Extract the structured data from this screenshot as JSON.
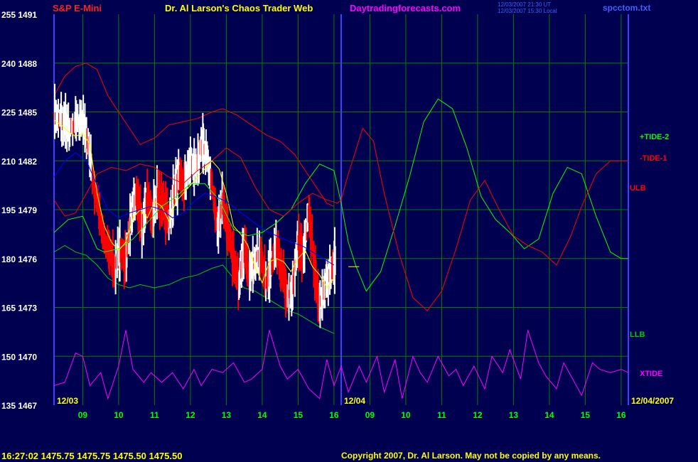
{
  "header": {
    "symbol": "S&P E-Mini",
    "site_title": "Dr. Al Larson's Chaos Trader Web",
    "url": "Daytradingforecasts.com",
    "timestamp_line1": "12/03/2007 21:30 UT",
    "timestamp_line2": "12/03/2007 15:30 Local",
    "filename": "spcctom.txt"
  },
  "footer": {
    "quote": "16:27:02  1475.75  1475.75  1475.50  1475.50",
    "copyright": "Copyright 2007, Dr. Al Larson. May not be copied by any means."
  },
  "colors": {
    "background": "#000050",
    "grid": "#008000",
    "frame": "#4040ff",
    "price_high": "#ffffff",
    "price_low": "#ff0000",
    "fast_average": "#ffff00",
    "slow_average": "#0000ff",
    "tide_plus_2": "#00ff00",
    "tide_minus_1": "#ff0000",
    "ulb": "#ff0000",
    "llb": "#00cc00",
    "xtide": "#ff00ff",
    "y_labels": "#ffffff",
    "x_labels": "#00ff00",
    "date_labels": "#ffff00"
  },
  "chart_data": {
    "type": "line",
    "y_axis": {
      "ticks": [
        {
          "osc": "255",
          "price": "1491"
        },
        {
          "osc": "240",
          "price": "1488"
        },
        {
          "osc": "225",
          "price": "1485"
        },
        {
          "osc": "210",
          "price": "1482"
        },
        {
          "osc": "195",
          "price": "1479"
        },
        {
          "osc": "180",
          "price": "1476"
        },
        {
          "osc": "165",
          "price": "1473"
        },
        {
          "osc": "150",
          "price": "1470"
        },
        {
          "osc": "135",
          "price": "1467"
        }
      ],
      "osc_range": [
        135,
        255
      ],
      "price_range": [
        1467,
        1491
      ],
      "grid": true
    },
    "x_axis": {
      "hour_ticks": [
        "09",
        "10",
        "11",
        "12",
        "13",
        "14",
        "15",
        "16",
        "09",
        "10",
        "11",
        "12",
        "13",
        "14",
        "15",
        "16"
      ],
      "range": [
        8.2,
        24.2
      ],
      "day_labels": [
        "12/03",
        "12/04",
        "12/04/2007"
      ],
      "day_divider": 16.2,
      "grid": true
    },
    "legend": {
      "tide_plus_2": "+TIDE-2",
      "tide_minus_1": "-TIDE-1",
      "ulb": "ULB",
      "llb": "LLB",
      "xtide": "XTIDE"
    },
    "series": [
      {
        "name": "+TIDE-2",
        "key": "tide_plus_2",
        "x": [
          8.2,
          8.6,
          9.0,
          9.4,
          9.6,
          10.0,
          10.4,
          10.8,
          11.2,
          11.6,
          12.0,
          12.4,
          12.8,
          13.2,
          13.6,
          14.0,
          14.4,
          14.8,
          15.2,
          15.6,
          16.0,
          16.2,
          16.4,
          16.6,
          16.9,
          17.3,
          17.7,
          18.1,
          18.5,
          18.9,
          19.3,
          19.7,
          20.1,
          20.5,
          20.9,
          21.3,
          21.7,
          22.1,
          22.5,
          22.9,
          23.3,
          23.7,
          24.0,
          24.2
        ],
        "y": [
          188,
          192,
          193,
          183,
          182,
          183,
          186,
          191,
          196,
          199,
          203,
          203,
          198,
          189,
          187,
          188,
          191,
          195,
          203,
          209,
          207,
          197,
          185,
          178,
          170,
          176,
          190,
          205,
          222,
          229,
          226,
          214,
          199,
          192,
          188,
          183,
          186,
          200,
          208,
          206,
          193,
          182,
          180,
          180
        ]
      },
      {
        "name": "-TIDE-1",
        "key": "tide_minus_1",
        "x": [
          8.2,
          8.5,
          8.8,
          9.1,
          9.4,
          9.8,
          10.2,
          10.6,
          11.0,
          11.4,
          11.8,
          12.2,
          12.6,
          13.0,
          13.4,
          13.8,
          14.2,
          14.6,
          15.0,
          15.4,
          15.8,
          16.1,
          16.2,
          16.4,
          16.8,
          17.1,
          17.4,
          17.8,
          18.2,
          18.6,
          19.0,
          19.4,
          19.8,
          20.2,
          20.6,
          21.0,
          21.4,
          21.8,
          22.2,
          22.6,
          22.9,
          23.3,
          23.7,
          24.0,
          24.2
        ],
        "y": [
          198,
          193,
          194,
          200,
          206,
          208,
          207,
          209,
          208,
          205,
          203,
          207,
          210,
          214,
          211,
          202,
          195,
          193,
          197,
          200,
          198,
          197,
          198,
          206,
          220,
          216,
          200,
          182,
          168,
          164,
          170,
          183,
          198,
          204,
          195,
          187,
          184,
          182,
          178,
          187,
          196,
          206,
          210,
          210,
          210
        ]
      },
      {
        "name": "ULB",
        "key": "ulb",
        "x": [
          8.2,
          8.5,
          8.8,
          9.1,
          9.4,
          9.7,
          10.0,
          10.3,
          10.6,
          11.0,
          11.4,
          11.8,
          12.2,
          12.6,
          12.9,
          13.3,
          13.7,
          14.1,
          14.5,
          14.9,
          15.2,
          15.5,
          15.8,
          16.0
        ],
        "y": [
          230,
          236,
          239,
          240,
          238,
          230,
          225,
          220,
          215,
          217,
          221,
          222,
          223,
          225,
          226,
          224,
          221,
          218,
          216,
          212,
          207,
          202,
          197,
          196
        ]
      },
      {
        "name": "LLB",
        "key": "llb",
        "x": [
          8.2,
          8.5,
          8.8,
          9.1,
          9.4,
          9.7,
          10.0,
          10.3,
          10.6,
          11.0,
          11.4,
          11.8,
          12.2,
          12.6,
          12.9,
          13.2,
          13.5,
          13.8,
          14.1,
          14.4,
          14.7,
          15.0,
          15.3,
          15.6,
          15.8,
          16.0
        ],
        "y": [
          182,
          184,
          182,
          181,
          178,
          174,
          172,
          171,
          172,
          171,
          172,
          174,
          175,
          177,
          178,
          174,
          171,
          170,
          168,
          166,
          164,
          163,
          161,
          159,
          158,
          157
        ]
      },
      {
        "name": "XTIDE",
        "key": "xtide",
        "x": [
          8.2,
          8.5,
          8.8,
          9.0,
          9.2,
          9.5,
          9.7,
          10.0,
          10.2,
          10.4,
          10.7,
          10.9,
          11.2,
          11.5,
          11.8,
          12.1,
          12.3,
          12.6,
          12.9,
          13.2,
          13.5,
          13.7,
          14.0,
          14.2,
          14.5,
          14.7,
          15.0,
          15.3,
          15.6,
          15.8,
          16.0,
          16.2,
          16.4,
          16.7,
          16.9,
          17.2,
          17.4,
          17.7,
          17.9,
          18.2,
          18.4,
          18.6,
          18.9,
          19.2,
          19.4,
          19.6,
          19.9,
          20.2,
          20.4,
          20.7,
          20.9,
          21.2,
          21.4,
          21.7,
          21.9,
          22.2,
          22.4,
          22.7,
          22.9,
          23.2,
          23.4,
          23.7,
          24.0,
          24.2
        ],
        "y": [
          141,
          142,
          151,
          150,
          141,
          145,
          137,
          147,
          158,
          146,
          142,
          145,
          142,
          145,
          140,
          146,
          141,
          146,
          145,
          148,
          142,
          143,
          146,
          158,
          147,
          143,
          146,
          140,
          137,
          149,
          141,
          147,
          139,
          147,
          142,
          150,
          139,
          149,
          137,
          150,
          145,
          142,
          150,
          144,
          146,
          141,
          147,
          140,
          150,
          145,
          152,
          143,
          158,
          148,
          144,
          140,
          148,
          142,
          138,
          148,
          146,
          145,
          146,
          145
        ]
      },
      {
        "name": "fast average",
        "key": "fast_average",
        "x": [
          8.2,
          8.4,
          8.6,
          8.8,
          9.0,
          9.2,
          9.4,
          9.6,
          9.8,
          10.0,
          10.2,
          10.4,
          10.6,
          10.8,
          11.0,
          11.2,
          11.4,
          11.6,
          11.8,
          12.0,
          12.2,
          12.4,
          12.6,
          12.8,
          13.0,
          13.2,
          13.4,
          13.6,
          13.8,
          14.0,
          14.2,
          14.4,
          14.6,
          14.8,
          15.0,
          15.2,
          15.4,
          15.6,
          15.8,
          16.0
        ],
        "y": [
          1484.5,
          1484.2,
          1483.8,
          1483.5,
          1483.7,
          1483.0,
          1480.0,
          1478.0,
          1477.0,
          1476.5,
          1477.0,
          1478.5,
          1479.0,
          1478.5,
          1479.5,
          1479.2,
          1478.3,
          1479.5,
          1480.0,
          1480.5,
          1481.0,
          1481.5,
          1482.0,
          1481.5,
          1480.0,
          1478.0,
          1477.5,
          1476.8,
          1475.5,
          1474.5,
          1475.8,
          1476.0,
          1475.8,
          1475.2,
          1476.0,
          1476.5,
          1475.5,
          1475.0,
          1474.2,
          1474.8
        ]
      },
      {
        "name": "slow average",
        "key": "slow_average",
        "x": [
          8.2,
          8.5,
          8.8,
          9.1,
          9.4,
          9.7,
          10.0,
          10.3,
          10.6,
          10.9,
          11.2,
          11.5,
          11.8,
          12.1,
          12.4,
          12.7,
          13.0,
          13.3,
          13.6,
          13.9,
          14.2,
          14.5,
          14.8,
          15.1,
          15.4,
          15.7,
          16.0
        ],
        "y": [
          1481.0,
          1482.0,
          1482.5,
          1482.0,
          1480.5,
          1479.0,
          1478.5,
          1478.8,
          1479.0,
          1479.2,
          1479.0,
          1478.5,
          1478.8,
          1479.5,
          1480.0,
          1479.8,
          1479.5,
          1479.0,
          1478.5,
          1478.0,
          1477.6,
          1477.3,
          1477.0,
          1476.8,
          1476.4,
          1476.0,
          1475.6
        ]
      },
      {
        "name": "price",
        "key": "price",
        "x": [
          8.2,
          8.4,
          8.6,
          8.8,
          9.0,
          9.15,
          9.3,
          9.45,
          9.6,
          9.75,
          9.9,
          10.05,
          10.2,
          10.35,
          10.5,
          10.65,
          10.8,
          10.95,
          11.1,
          11.25,
          11.4,
          11.55,
          11.7,
          11.85,
          12.0,
          12.15,
          12.3,
          12.45,
          12.6,
          12.75,
          12.9,
          13.05,
          13.2,
          13.35,
          13.5,
          13.65,
          13.8,
          13.95,
          14.1,
          14.25,
          14.4,
          14.55,
          14.7,
          14.85,
          15.0,
          15.15,
          15.3,
          15.45,
          15.6,
          15.75,
          15.9,
          16.05
        ],
        "y": [
          1484.8,
          1484.5,
          1484.0,
          1484.2,
          1484.5,
          1483.0,
          1480.5,
          1479.0,
          1477.0,
          1476.5,
          1475.5,
          1476.5,
          1476.0,
          1478.5,
          1480.0,
          1478.0,
          1479.5,
          1478.8,
          1479.8,
          1479.2,
          1478.5,
          1480.2,
          1481.0,
          1480.5,
          1482.0,
          1481.5,
          1483.0,
          1482.5,
          1480.5,
          1478.0,
          1479.5,
          1477.5,
          1476.0,
          1474.5,
          1476.5,
          1475.0,
          1475.8,
          1476.5,
          1474.5,
          1475.5,
          1476.8,
          1475.2,
          1473.5,
          1474.2,
          1477.0,
          1476.0,
          1479.0,
          1475.5,
          1473.0,
          1474.2,
          1475.2,
          1476.0
        ]
      },
      {
        "name": "current",
        "key": "fast_average",
        "x": [
          16.4,
          16.7
        ],
        "y": [
          1475.5,
          1475.5
        ]
      }
    ]
  }
}
